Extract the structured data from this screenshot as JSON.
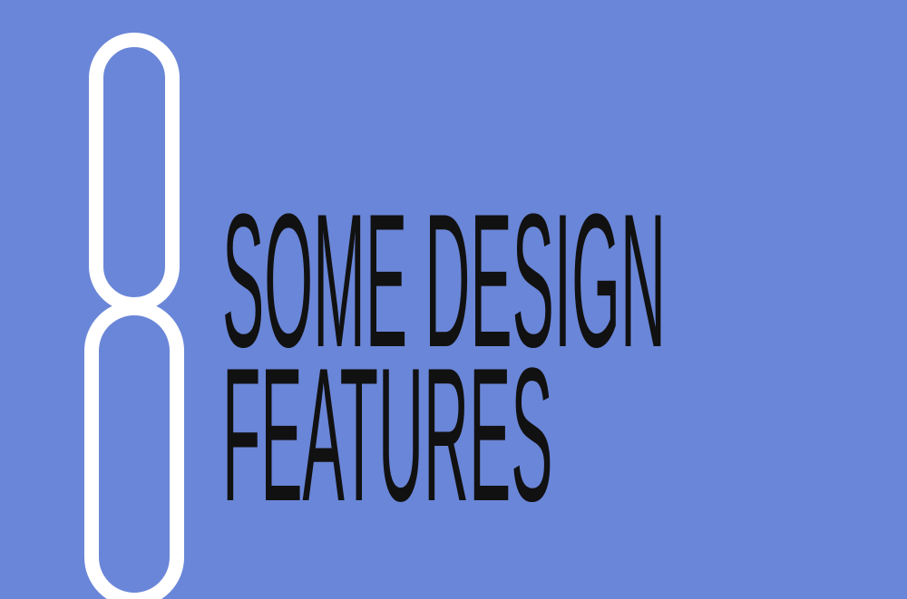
{
  "slide": {
    "chapter_number": "8",
    "title_line_1": "SOME DESIGN",
    "title_line_2": "FEATURES"
  },
  "colors": {
    "background": "#6a86d8",
    "number": "#ffffff",
    "title": "#111111"
  }
}
